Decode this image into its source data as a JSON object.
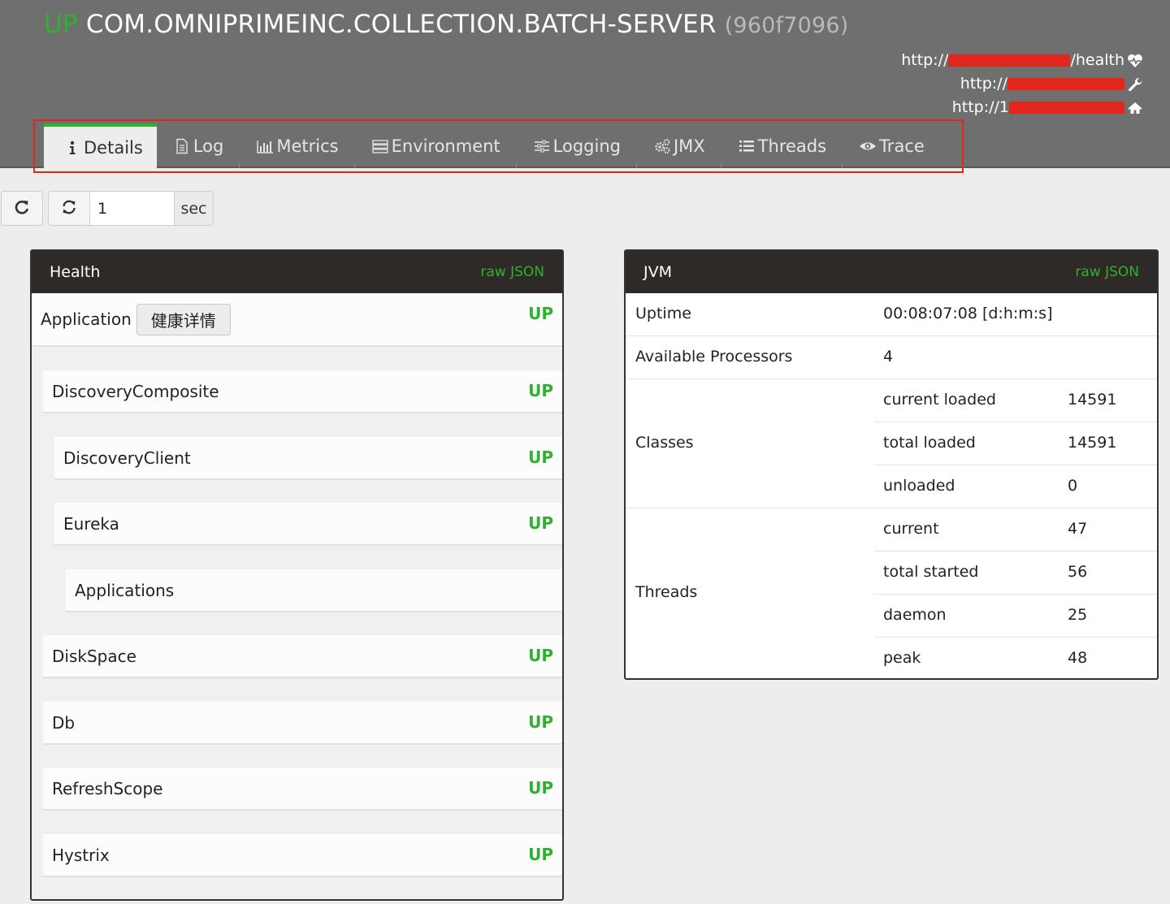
{
  "app": {
    "status": "UP",
    "name": "COM.OMNIPRIMEINC.COLLECTION.BATCH-SERVER",
    "id": "(960f7096)"
  },
  "urls": [
    {
      "prefix": "http://",
      "suffix": "/health",
      "icon": "heartbeat-icon"
    },
    {
      "prefix": "http://",
      "suffix": "",
      "icon": "wrench-icon"
    },
    {
      "prefix": "http://1",
      "suffix": "",
      "icon": "home-icon"
    }
  ],
  "tabs": [
    {
      "label": "Details",
      "icon": "info-icon"
    },
    {
      "label": "Log",
      "icon": "file-icon"
    },
    {
      "label": "Metrics",
      "icon": "bar-chart-icon"
    },
    {
      "label": "Environment",
      "icon": "server-icon"
    },
    {
      "label": "Logging",
      "icon": "sliders-icon"
    },
    {
      "label": "JMX",
      "icon": "gears-icon"
    },
    {
      "label": "Threads",
      "icon": "list-icon"
    },
    {
      "label": "Trace",
      "icon": "eye-icon"
    }
  ],
  "refresh": {
    "interval_value": "1",
    "unit": "sec"
  },
  "health": {
    "title": "Health",
    "raw_json": "raw JSON",
    "application": {
      "label": "Application",
      "detail_button": "健康详情",
      "status": "UP"
    },
    "items": [
      {
        "name": "DiscoveryComposite",
        "status": "UP"
      },
      {
        "name": "DiscoveryClient",
        "status": "UP"
      },
      {
        "name": "Eureka",
        "status": "UP"
      },
      {
        "name": "Applications",
        "status": ""
      },
      {
        "name": "DiskSpace",
        "status": "UP"
      },
      {
        "name": "Db",
        "status": "UP"
      },
      {
        "name": "RefreshScope",
        "status": "UP"
      },
      {
        "name": "Hystrix",
        "status": "UP"
      }
    ]
  },
  "jvm": {
    "title": "JVM",
    "raw_json": "raw JSON",
    "uptime": {
      "label": "Uptime",
      "value": "00:08:07:08 [d:h:m:s]"
    },
    "processors": {
      "label": "Available Processors",
      "value": "4"
    },
    "classes": {
      "label": "Classes",
      "rows": [
        {
          "label": "current loaded",
          "value": "14591"
        },
        {
          "label": "total loaded",
          "value": "14591"
        },
        {
          "label": "unloaded",
          "value": "0"
        }
      ]
    },
    "threads": {
      "label": "Threads",
      "rows": [
        {
          "label": "current",
          "value": "47"
        },
        {
          "label": "total started",
          "value": "56"
        },
        {
          "label": "daemon",
          "value": "25"
        },
        {
          "label": "peak",
          "value": "48"
        }
      ]
    }
  },
  "colors": {
    "header_bg": "#6f6f6f",
    "status_green": "#2fb12f",
    "panel_head": "#2e2a28",
    "redaction": "#e3261c"
  }
}
